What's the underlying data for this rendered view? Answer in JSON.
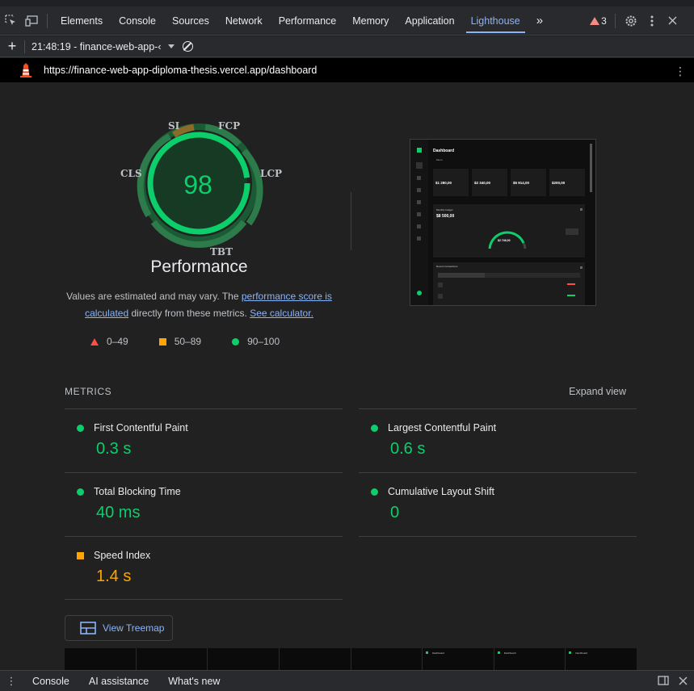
{
  "devtools": {
    "tabs": [
      "Elements",
      "Console",
      "Sources",
      "Network",
      "Performance",
      "Memory",
      "Application",
      "Lighthouse"
    ],
    "active_tab": "Lighthouse",
    "more_tabs": "»",
    "warnings_count": "3"
  },
  "toolbar": {
    "add": "+",
    "report_label": "21:48:19 - finance-web-app-‹"
  },
  "url": "https://finance-web-app-diploma-thesis.vercel.app/dashboard",
  "gauge": {
    "score": "98",
    "labels": {
      "si": "SI",
      "fcp": "FCP",
      "lcp": "LCP",
      "tbt": "TBT",
      "cls": "CLS"
    },
    "title": "Performance"
  },
  "note": {
    "prefix": "Values are estimated and may vary. The ",
    "link1": "performance score is calculated",
    "middle": " directly from these metrics. ",
    "link2": "See calculator."
  },
  "legend": {
    "fail": "0–49",
    "average": "50–89",
    "pass": "90–100"
  },
  "screenshot": {
    "title": "Dashboard",
    "menu": "Menu",
    "cards": [
      "$1 280,00",
      "$2 340,00",
      "$5 914,00",
      "$200,00"
    ],
    "budget_label": "Monthly budget",
    "budget_value": "$8 500,00",
    "gauge_value": "$2 746,00",
    "recent": "Recent transactions"
  },
  "metrics": {
    "heading": "METRICS",
    "expand": "Expand view",
    "items": [
      {
        "name": "First Contentful Paint",
        "value": "0.3 s",
        "status": "pass"
      },
      {
        "name": "Largest Contentful Paint",
        "value": "0.6 s",
        "status": "pass"
      },
      {
        "name": "Total Blocking Time",
        "value": "40 ms",
        "status": "pass"
      },
      {
        "name": "Cumulative Layout Shift",
        "value": "0",
        "status": "pass"
      },
      {
        "name": "Speed Index",
        "value": "1.4 s",
        "status": "average"
      }
    ]
  },
  "treemap_label": "View Treemap",
  "filmstrip": {
    "frame_title": "Dashboard"
  },
  "drawer": {
    "tabs": [
      "Console",
      "AI assistance",
      "What's new"
    ]
  },
  "colors": {
    "pass": "#0cce6b",
    "average": "#ffa400",
    "fail": "#ff4e42",
    "link": "#8ab4f8"
  }
}
